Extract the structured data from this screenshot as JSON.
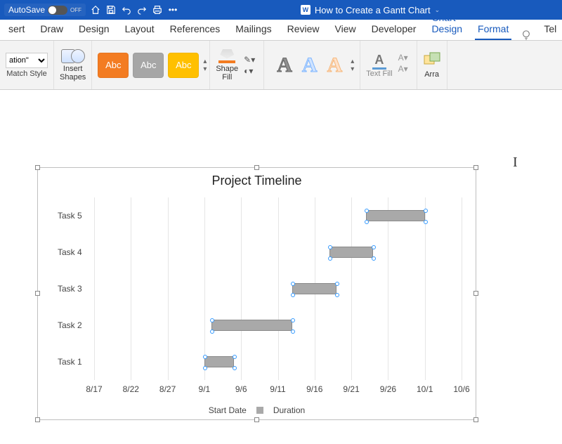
{
  "titlebar": {
    "autosave_label": "AutoSave",
    "autosave_state": "OFF",
    "doc_title": "How to Create a Gantt Chart"
  },
  "tabs": {
    "items": [
      "sert",
      "Draw",
      "Design",
      "Layout",
      "References",
      "Mailings",
      "Review",
      "View",
      "Developer",
      "Chart Design",
      "Format"
    ],
    "tell": "Tel"
  },
  "ribbon": {
    "style_placeholder": "ation\"",
    "match_style": "Match Style",
    "insert_shapes": "Insert\nShapes",
    "abc": "Abc",
    "shape_fill": "Shape\nFill",
    "text_fill": "Text Fill",
    "arrange": "Arra"
  },
  "chart_data": {
    "type": "bar",
    "title": "Project Timeline",
    "categories": [
      "Task 5",
      "Task 4",
      "Task 3",
      "Task 2",
      "Task 1"
    ],
    "x_ticks": [
      "8/17",
      "8/22",
      "8/27",
      "9/1",
      "9/6",
      "9/11",
      "9/16",
      "9/21",
      "9/26",
      "10/1",
      "10/6"
    ],
    "series": [
      {
        "name": "Start Date",
        "values_as_tick_index": [
          7.4,
          6.4,
          5.4,
          3.2,
          3.0
        ]
      },
      {
        "name": "Duration",
        "values_as_span": [
          1.6,
          1.2,
          1.2,
          2.2,
          0.8
        ]
      }
    ],
    "legend": [
      "Start Date",
      "Duration"
    ]
  }
}
